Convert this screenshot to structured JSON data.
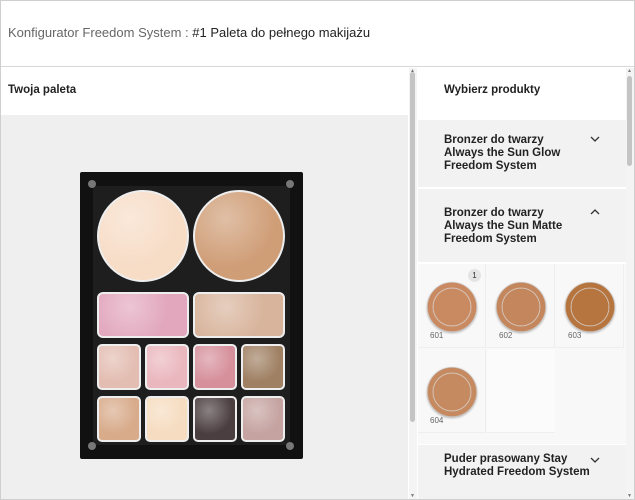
{
  "header": {
    "app_title": "Konfigurator Freedom System",
    "separator": ":",
    "palette_name": "#1 Paleta do pełnego makijażu"
  },
  "left_panel": {
    "title": "Twoja paleta"
  },
  "palette": {
    "frame_color": "#111111",
    "pans": [
      {
        "shape": "round",
        "color": "#f7dcc6"
      },
      {
        "shape": "round",
        "color": "#cf9d76"
      },
      {
        "shape": "rect",
        "color": "#e2a7bd"
      },
      {
        "shape": "rect",
        "color": "#d8b49c"
      },
      {
        "shape": "square",
        "color": "#e3bdb2"
      },
      {
        "shape": "square",
        "color": "#eab7be"
      },
      {
        "shape": "square",
        "color": "#d6909c"
      },
      {
        "shape": "square",
        "color": "#9f8063"
      },
      {
        "shape": "square",
        "color": "#d8ab8b"
      },
      {
        "shape": "square",
        "color": "#f6dcc0"
      },
      {
        "shape": "square",
        "color": "#4b3e40"
      },
      {
        "shape": "square",
        "color": "#c5a3a1"
      }
    ]
  },
  "right_panel": {
    "title": "Wybierz produkty",
    "accordion": [
      {
        "label": "Bronzer do twarzy Always the Sun Glow Freedom System",
        "expanded": false,
        "icon": "chevron-down-icon"
      },
      {
        "label": "Bronzer do twarzy Always the Sun Matte Freedom System",
        "expanded": true,
        "icon": "chevron-up-icon"
      },
      {
        "label": "Puder prasowany Stay Hydrated Freedom System",
        "expanded": false,
        "icon": "chevron-down-icon"
      }
    ],
    "products": [
      {
        "code": "601",
        "color": "#c98a62",
        "badge": "1"
      },
      {
        "code": "602",
        "color": "#c4865c",
        "badge": ""
      },
      {
        "code": "603",
        "color": "#b6743f",
        "badge": ""
      },
      {
        "code": "604",
        "color": "#c58a60",
        "badge": ""
      }
    ]
  }
}
